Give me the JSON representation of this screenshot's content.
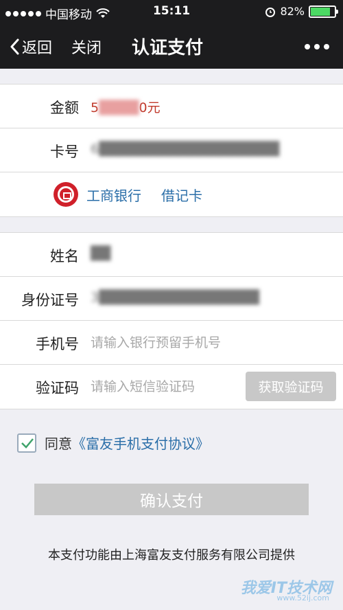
{
  "status_bar": {
    "carrier": "中国移动",
    "time": "15:11",
    "battery": "82%",
    "battery_level": 0.82
  },
  "nav": {
    "back_label": "返回",
    "close_label": "关闭",
    "title": "认证支付",
    "more_icon": "more-icon"
  },
  "card_info": {
    "amount_label": "金额",
    "amount_prefix": "5",
    "amount_masked": "████",
    "amount_suffix": "0元",
    "card_label": "卡号",
    "card_masked": "6██████████████████",
    "bank_name": "工商银行",
    "card_type": "借记卡"
  },
  "identity": {
    "name_label": "姓名",
    "name_masked": "██",
    "id_label": "身份证号",
    "id_masked": "3████████████████",
    "phone_label": "手机号",
    "phone_placeholder": "请输入银行预留手机号",
    "code_label": "验证码",
    "code_placeholder": "请输入短信验证码",
    "code_button": "获取验证码"
  },
  "agreement": {
    "checked": true,
    "prefix": "同意",
    "link": "《富友手机支付协议》"
  },
  "confirm_label": "确认支付",
  "footer": "本支付功能由上海富友支付服务有限公司提供",
  "watermark": {
    "title": "我爱IT技术网",
    "url": "www.52ij.com"
  },
  "colors": {
    "nav_bg": "#1c1c1e",
    "link": "#2a6ea8",
    "bank_red": "#d0202a",
    "disabled": "#c8c8c8"
  }
}
